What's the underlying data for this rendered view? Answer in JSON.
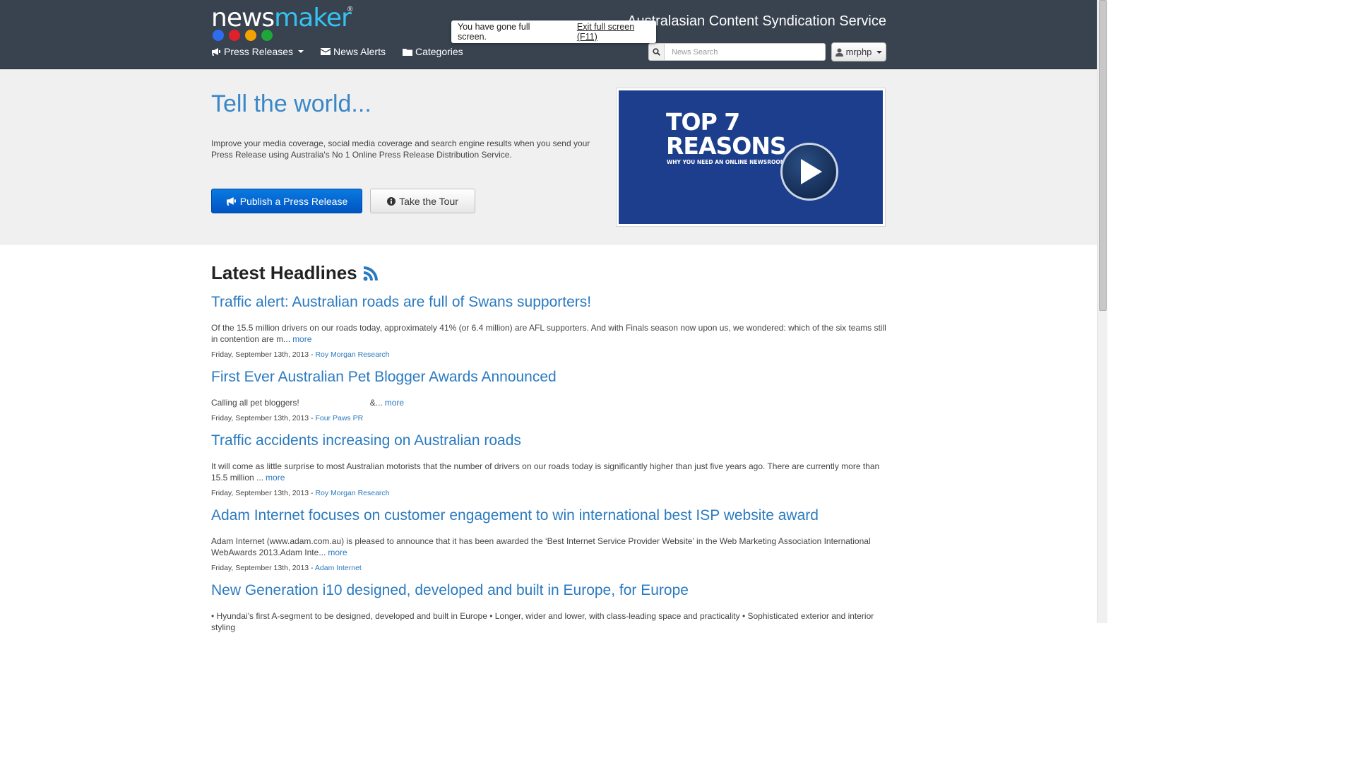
{
  "header": {
    "logo_part1": "news",
    "logo_part2": "maker",
    "logo_reg": "®",
    "logo_dot_colors": [
      "#2e6df0",
      "#e0202a",
      "#f2a300",
      "#1fa63a"
    ],
    "tagline": "Australasian Content Syndication Service",
    "nav": [
      {
        "label": "Press Releases",
        "icon": "megaphone-icon",
        "has_dropdown": true
      },
      {
        "label": "News Alerts",
        "icon": "envelope-icon",
        "has_dropdown": false
      },
      {
        "label": "Categories",
        "icon": "folder-icon",
        "has_dropdown": false
      }
    ],
    "search_placeholder": "News Search",
    "user_label": "mrphp"
  },
  "fullscreen_notice": {
    "message": "You have gone full screen.",
    "exit_label": "Exit full screen (F11)"
  },
  "hero": {
    "title": "Tell the world...",
    "description": "Improve your media coverage, social media coverage and search engine results when you send your Press Release using Australia's No 1 Online Press Release Distribution Service.",
    "publish_label": "Publish a Press Release",
    "tour_label": "Take the Tour",
    "video": {
      "line1": "TOP 7",
      "line2": "REASONS",
      "subtitle": "WHY YOU NEED AN ONLINE NEWSROOM"
    }
  },
  "headlines": {
    "title": "Latest Headlines",
    "articles": [
      {
        "title": "Traffic alert: Australian roads are full of Swans supporters!",
        "body": "Of the 15.5 million drivers on our roads today, approximately 41% (or 6.4 million) are AFL supporters. And with Finals season now upon us, we wondered: which of the six teams still in contention are m...",
        "more": "more",
        "date": "Friday, September 13th, 2013 - ",
        "source": "Roy Morgan Research"
      },
      {
        "title": "First Ever Australian Pet Blogger Awards Announced",
        "body": "Calling all pet bloggers!                              &...",
        "more": "more",
        "date": "Friday, September 13th, 2013 - ",
        "source": "Four Paws PR"
      },
      {
        "title": "Traffic accidents increasing on Australian roads",
        "body": "It will come as little surprise to most Australian motorists that the number of drivers on our roads today is significantly higher than just five years ago. There are currently more than 15.5 million ...",
        "more": "more",
        "date": "Friday, September 13th, 2013 - ",
        "source": "Roy Morgan Research"
      },
      {
        "title": "Adam Internet focuses on customer engagement to win international best ISP website award",
        "body": "Adam Internet (www.adam.com.au) is pleased to announce that it has been awarded the ‘Best Internet Service Provider Website’ in the Web Marketing Association International WebAwards 2013.Adam Inte...",
        "more": "more",
        "date": "Friday, September 13th, 2013 - ",
        "source": "Adam Internet"
      },
      {
        "title": "New Generation i10 designed, developed and built in Europe, for Europe",
        "body": "• Hyundai’s first A-segment to be designed, developed and built in Europe • Longer, wider and lower, with class-leading space and practicality • Sophisticated exterior and interior styling",
        "more": "",
        "date": "",
        "source": ""
      }
    ]
  }
}
